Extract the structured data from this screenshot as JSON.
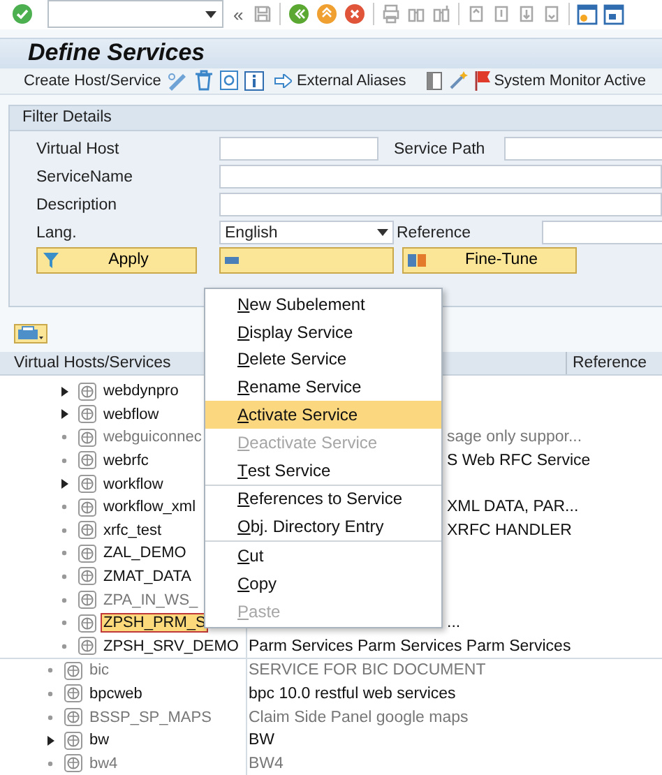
{
  "system_toolbar": {
    "collapse_glyph": "«"
  },
  "title": "Define Services",
  "app_toolbar": {
    "create_label": "Create Host/Service",
    "aliases_label": "External Aliases",
    "monitor_label": "System Monitor Active"
  },
  "filter": {
    "header": "Filter Details",
    "virtual_host": {
      "label": "Virtual Host"
    },
    "service_path": {
      "label": "Service Path"
    },
    "service_name": {
      "label": "ServiceName"
    },
    "description": {
      "label": "Description"
    },
    "lang": {
      "label": "Lang.",
      "value": "English"
    },
    "reference": {
      "label": "Reference"
    },
    "buttons": [
      {
        "kind": "filter",
        "label": "Apply"
      },
      {
        "kind": "hidden"
      },
      {
        "kind": "tune",
        "label": "Fine-Tune"
      }
    ]
  },
  "table": {
    "columns": [
      "Virtual Hosts/Services",
      "Reference"
    ],
    "nested_rows": [
      {
        "name": "webdynpro",
        "expandable": true,
        "active": true,
        "selected": false
      },
      {
        "name": "webflow",
        "expandable": true,
        "active": true,
        "selected": false
      },
      {
        "name": "webguiconnec",
        "description": "sage only suppor...",
        "expandable": false,
        "active": false,
        "selected": false
      },
      {
        "name": "webrfc",
        "description": "S Web RFC Service",
        "expandable": false,
        "active": true,
        "selected": false
      },
      {
        "name": "workflow",
        "expandable": true,
        "active": true,
        "selected": false
      },
      {
        "name": "workflow_xml",
        "description": "XML DATA, PAR...",
        "expandable": false,
        "active": true,
        "selected": false
      },
      {
        "name": "xrfc_test",
        "description": "XRFC HANDLER",
        "expandable": false,
        "active": true,
        "selected": false
      },
      {
        "name": "ZAL_DEMO",
        "expandable": false,
        "active": true,
        "selected": false
      },
      {
        "name": "ZMAT_DATA",
        "expandable": false,
        "active": true,
        "selected": false
      },
      {
        "name": "ZPA_IN_WS_",
        "expandable": false,
        "active": false,
        "selected": false
      },
      {
        "name": "ZPSH_PRM_S",
        "description": "...",
        "expandable": false,
        "active": true,
        "selected": true
      },
      {
        "name": "ZPSH_SRV_DEMO",
        "description": "Parm Services Parm Services Parm Services",
        "expandable": false,
        "active": true,
        "selected": false
      }
    ],
    "rows": [
      {
        "name": "bic",
        "description": "SERVICE FOR BIC DOCUMENT",
        "expandable": false,
        "active": false,
        "selected": false
      },
      {
        "name": "bpcweb",
        "description": "bpc 10.0 restful web services",
        "expandable": false,
        "active": true,
        "selected": false
      },
      {
        "name": "BSSP_SP_MAPS",
        "description": "Claim Side Panel google maps",
        "expandable": false,
        "active": false,
        "selected": false
      },
      {
        "name": "bw",
        "description": "BW",
        "expandable": true,
        "active": true,
        "selected": false
      },
      {
        "name": "bw4",
        "description": "BW4",
        "expandable": false,
        "active": false,
        "selected": false
      }
    ]
  },
  "context_menu": {
    "sections": [
      [
        {
          "label": "New Subelement",
          "disabled": false,
          "selected": false
        },
        {
          "label": "Display Service",
          "disabled": false,
          "selected": false
        },
        {
          "label": "Delete Service",
          "disabled": false,
          "selected": false
        },
        {
          "label": "Rename Service",
          "disabled": false,
          "selected": false
        },
        {
          "label": "Activate Service",
          "disabled": false,
          "selected": true
        },
        {
          "label": "Deactivate Service",
          "disabled": true,
          "selected": false
        },
        {
          "label": "Test Service",
          "disabled": false,
          "selected": false
        }
      ],
      [
        {
          "label": "References to Service",
          "disabled": false,
          "selected": false
        },
        {
          "label": "Obj. Directory Entry",
          "disabled": false,
          "selected": false
        }
      ],
      [
        {
          "label": "Cut",
          "disabled": false,
          "selected": false
        },
        {
          "label": "Copy",
          "disabled": false,
          "selected": false
        },
        {
          "label": "Paste",
          "disabled": true,
          "selected": false
        }
      ]
    ]
  }
}
